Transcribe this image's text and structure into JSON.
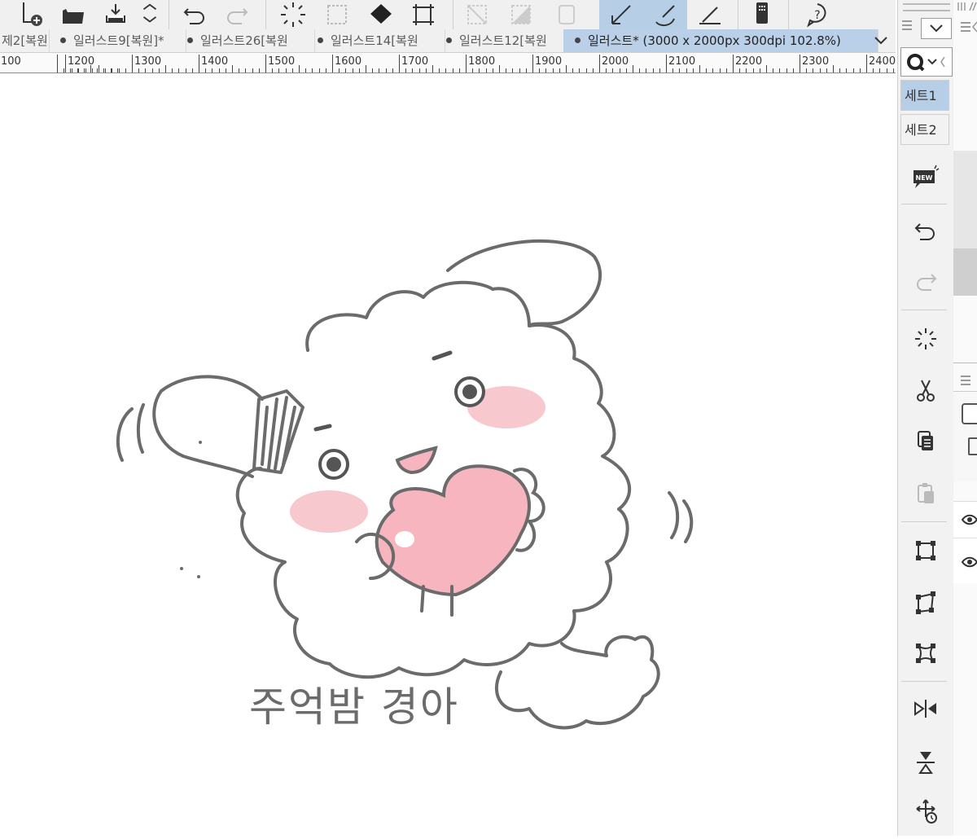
{
  "tabs": [
    {
      "label": "제2[복원",
      "active": false
    },
    {
      "label": "일러스트9[복원]*",
      "active": false
    },
    {
      "label": "일러스트26[복원",
      "active": false
    },
    {
      "label": "일러스트14[복원",
      "active": false
    },
    {
      "label": "일러스트12[복원",
      "active": false
    },
    {
      "label": "일러스트* (3000 x 2000px 300dpi 102.8%)",
      "active": true
    }
  ],
  "ruler": {
    "labels": [
      "100",
      "1200",
      "1300",
      "1400",
      "1500",
      "1600",
      "1700",
      "1800",
      "1900",
      "2000",
      "2100",
      "2200",
      "2300",
      "2400"
    ]
  },
  "command_bar": {
    "sets": [
      {
        "label": "세트1",
        "selected": true
      },
      {
        "label": "세트2",
        "selected": false
      }
    ],
    "new_badge": "NEW"
  },
  "canvas": {
    "handwritten_text": "주억밤 경아"
  },
  "icons": {
    "toolbar": [
      "new-file-icon",
      "open-folder-icon",
      "save-icon",
      "expand-collapse-icon",
      "undo-icon",
      "redo-icon",
      "clear-selection-icon",
      "selection-marquee-icon",
      "fill-icon",
      "transform-icon",
      "hide-selection-icon",
      "select-all-icon",
      "invert-selection-icon",
      "pen-tool-icon",
      "brush-tool-icon",
      "ruler-pen-icon",
      "smartphone-icon",
      "help-icon"
    ],
    "side": [
      "new-icon",
      "undo-icon",
      "redo-icon",
      "clear-icon",
      "cut-icon",
      "copy-icon",
      "paste-icon",
      "scale-icon",
      "free-transform-icon",
      "mesh-transform-icon",
      "flip-horizontal-icon",
      "flip-vertical-icon",
      "move-icon"
    ]
  },
  "colors": {
    "accent_selected": "#b7cfe6",
    "line": "#666666",
    "heart_fill": "#f7b6bf",
    "blush": "#f8c8cf"
  }
}
